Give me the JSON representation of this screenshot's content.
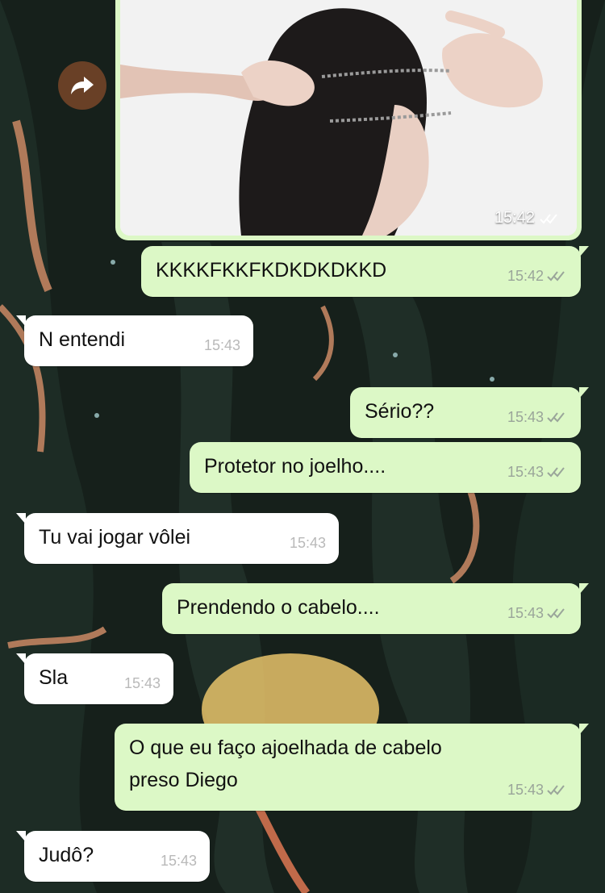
{
  "theme": {
    "outgoing_bubble": "#dcf8c6",
    "incoming_bubble": "#ffffff",
    "read_ticks": "#9aa59a",
    "wallpaper_base": "#16201b"
  },
  "image_message": {
    "time": "15:42",
    "status": "read",
    "icon": "photo-of-hair-tying"
  },
  "forward_button": {
    "icon": "forward-arrow-icon"
  },
  "messages": [
    {
      "dir": "out",
      "text": "KKKKFKKFKDKDKDKKD",
      "time": "15:42"
    },
    {
      "dir": "in",
      "text": "N entendi",
      "time": "15:43"
    },
    {
      "dir": "out",
      "text": "Sério??",
      "time": "15:43"
    },
    {
      "dir": "out",
      "text": "Protetor no joelho....",
      "time": "15:43"
    },
    {
      "dir": "in",
      "text": "Tu vai jogar vôlei",
      "time": "15:43"
    },
    {
      "dir": "out",
      "text": "Prendendo o cabelo....",
      "time": "15:43"
    },
    {
      "dir": "in",
      "text": "Sla",
      "time": "15:43"
    },
    {
      "dir": "out",
      "text_line1": "O que eu faço ajoelhada de cabelo",
      "text_line2": "preso Diego",
      "time": "15:43"
    },
    {
      "dir": "in",
      "text": "Judô?",
      "time": "15:43"
    }
  ]
}
